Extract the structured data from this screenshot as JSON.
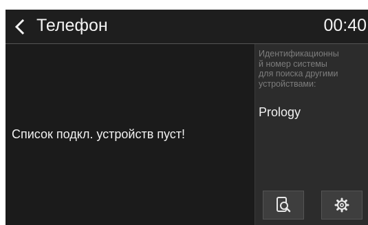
{
  "header": {
    "back_icon": "chevron-left-icon",
    "title": "Телефон",
    "time": "00:40"
  },
  "main": {
    "empty_message": "Список подкл. устройств пуст!"
  },
  "side_panel": {
    "label": "Идентификационны\nй номер системы\nдля поиска другими\nустройствами:",
    "device_name": "Prology",
    "buttons": [
      {
        "icon": "phone-search-icon"
      },
      {
        "icon": "gear-icon"
      }
    ]
  },
  "colors": {
    "header_bg": "#1e1e1e",
    "main_bg": "#1b1b1b",
    "side_bg": "#2c2c2c",
    "button_bg": "#3e3e3e",
    "text": "#f1f1f1",
    "muted_text": "#7d7d7d"
  }
}
